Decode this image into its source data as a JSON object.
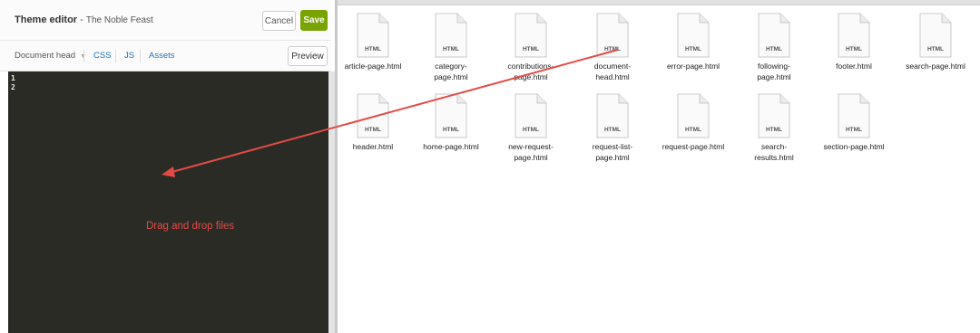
{
  "editor": {
    "title_main": "Theme editor",
    "title_sep": " - ",
    "title_sub": "The Noble Feast",
    "cancel_label": "Cancel",
    "save_label": "Save",
    "save_color": "#78a300",
    "toolbar": {
      "document_dropdown": "Document head",
      "tabs": [
        "CSS",
        "JS",
        "Assets"
      ],
      "preview_label": "Preview"
    },
    "code": {
      "line_numbers": [
        "1",
        "2"
      ],
      "background": "#2a2b25"
    },
    "drop_hint": "Drag and drop files",
    "annotation_color": "#e34a47"
  },
  "finder": {
    "file_icon": "html-file-icon",
    "icon_label": "HTML",
    "files_row1": [
      "article-page.html",
      "category-\npage.html",
      "contributions-\npage.html",
      "document-\nhead.html",
      "error-page.html",
      "following-\npage.html",
      "footer.html",
      "search-page.html"
    ],
    "files_row2": [
      "header.html",
      "home-page.html",
      "new-request-\npage.html",
      "request-list-\npage.html",
      "request-page.html",
      "search-\nresults.html",
      "section-page.html"
    ]
  }
}
